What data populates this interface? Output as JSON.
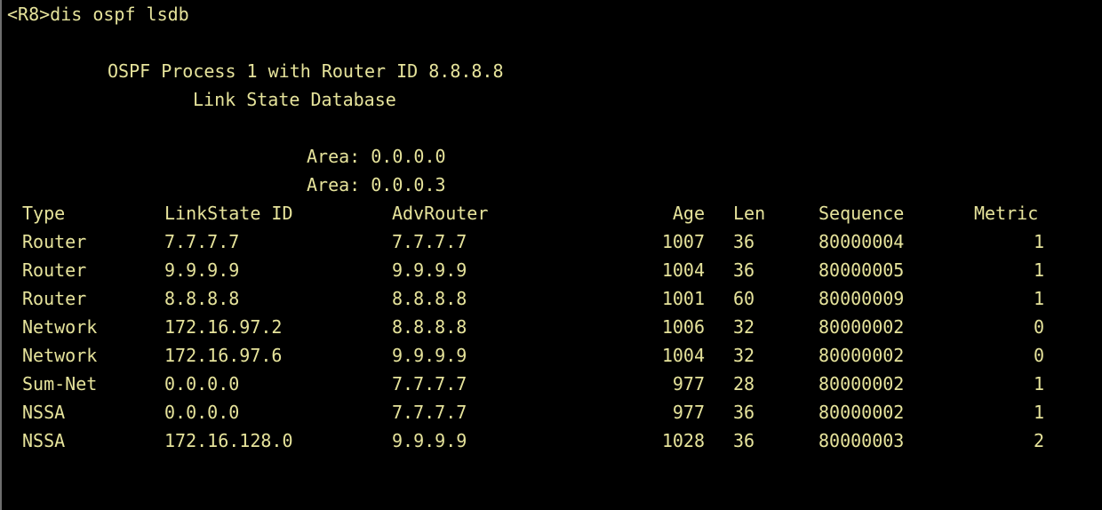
{
  "terminal": {
    "prompt": "<R8>dis ospf lsdb",
    "process_line": "OSPF Process 1 with Router ID 8.8.8.8",
    "db_title": "Link State Database",
    "areas": [
      "Area: 0.0.0.0",
      "Area: 0.0.0.3"
    ],
    "colors": {
      "background": "#000000",
      "text": "#e6e39b"
    }
  },
  "table": {
    "headers": {
      "type": "Type",
      "linkstate_id": "LinkState ID",
      "advrouter": "AdvRouter",
      "age": "Age",
      "len": "Len",
      "sequence": "Sequence",
      "metric": "Metric"
    },
    "rows": [
      {
        "type": "Router",
        "linkstate_id": "7.7.7.7",
        "advrouter": "7.7.7.7",
        "age": "1007",
        "len": "36",
        "sequence": "80000004",
        "metric": "1"
      },
      {
        "type": "Router",
        "linkstate_id": "9.9.9.9",
        "advrouter": "9.9.9.9",
        "age": "1004",
        "len": "36",
        "sequence": "80000005",
        "metric": "1"
      },
      {
        "type": "Router",
        "linkstate_id": "8.8.8.8",
        "advrouter": "8.8.8.8",
        "age": "1001",
        "len": "60",
        "sequence": "80000009",
        "metric": "1"
      },
      {
        "type": "Network",
        "linkstate_id": "172.16.97.2",
        "advrouter": "8.8.8.8",
        "age": "1006",
        "len": "32",
        "sequence": "80000002",
        "metric": "0"
      },
      {
        "type": "Network",
        "linkstate_id": "172.16.97.6",
        "advrouter": "9.9.9.9",
        "age": "1004",
        "len": "32",
        "sequence": "80000002",
        "metric": "0"
      },
      {
        "type": "Sum-Net",
        "linkstate_id": "0.0.0.0",
        "advrouter": "7.7.7.7",
        "age": "977",
        "len": "28",
        "sequence": "80000002",
        "metric": "1"
      },
      {
        "type": "NSSA",
        "linkstate_id": "0.0.0.0",
        "advrouter": "7.7.7.7",
        "age": "977",
        "len": "36",
        "sequence": "80000002",
        "metric": "1"
      },
      {
        "type": "NSSA",
        "linkstate_id": "172.16.128.0",
        "advrouter": "9.9.9.9",
        "age": "1028",
        "len": "36",
        "sequence": "80000003",
        "metric": "2"
      }
    ]
  }
}
